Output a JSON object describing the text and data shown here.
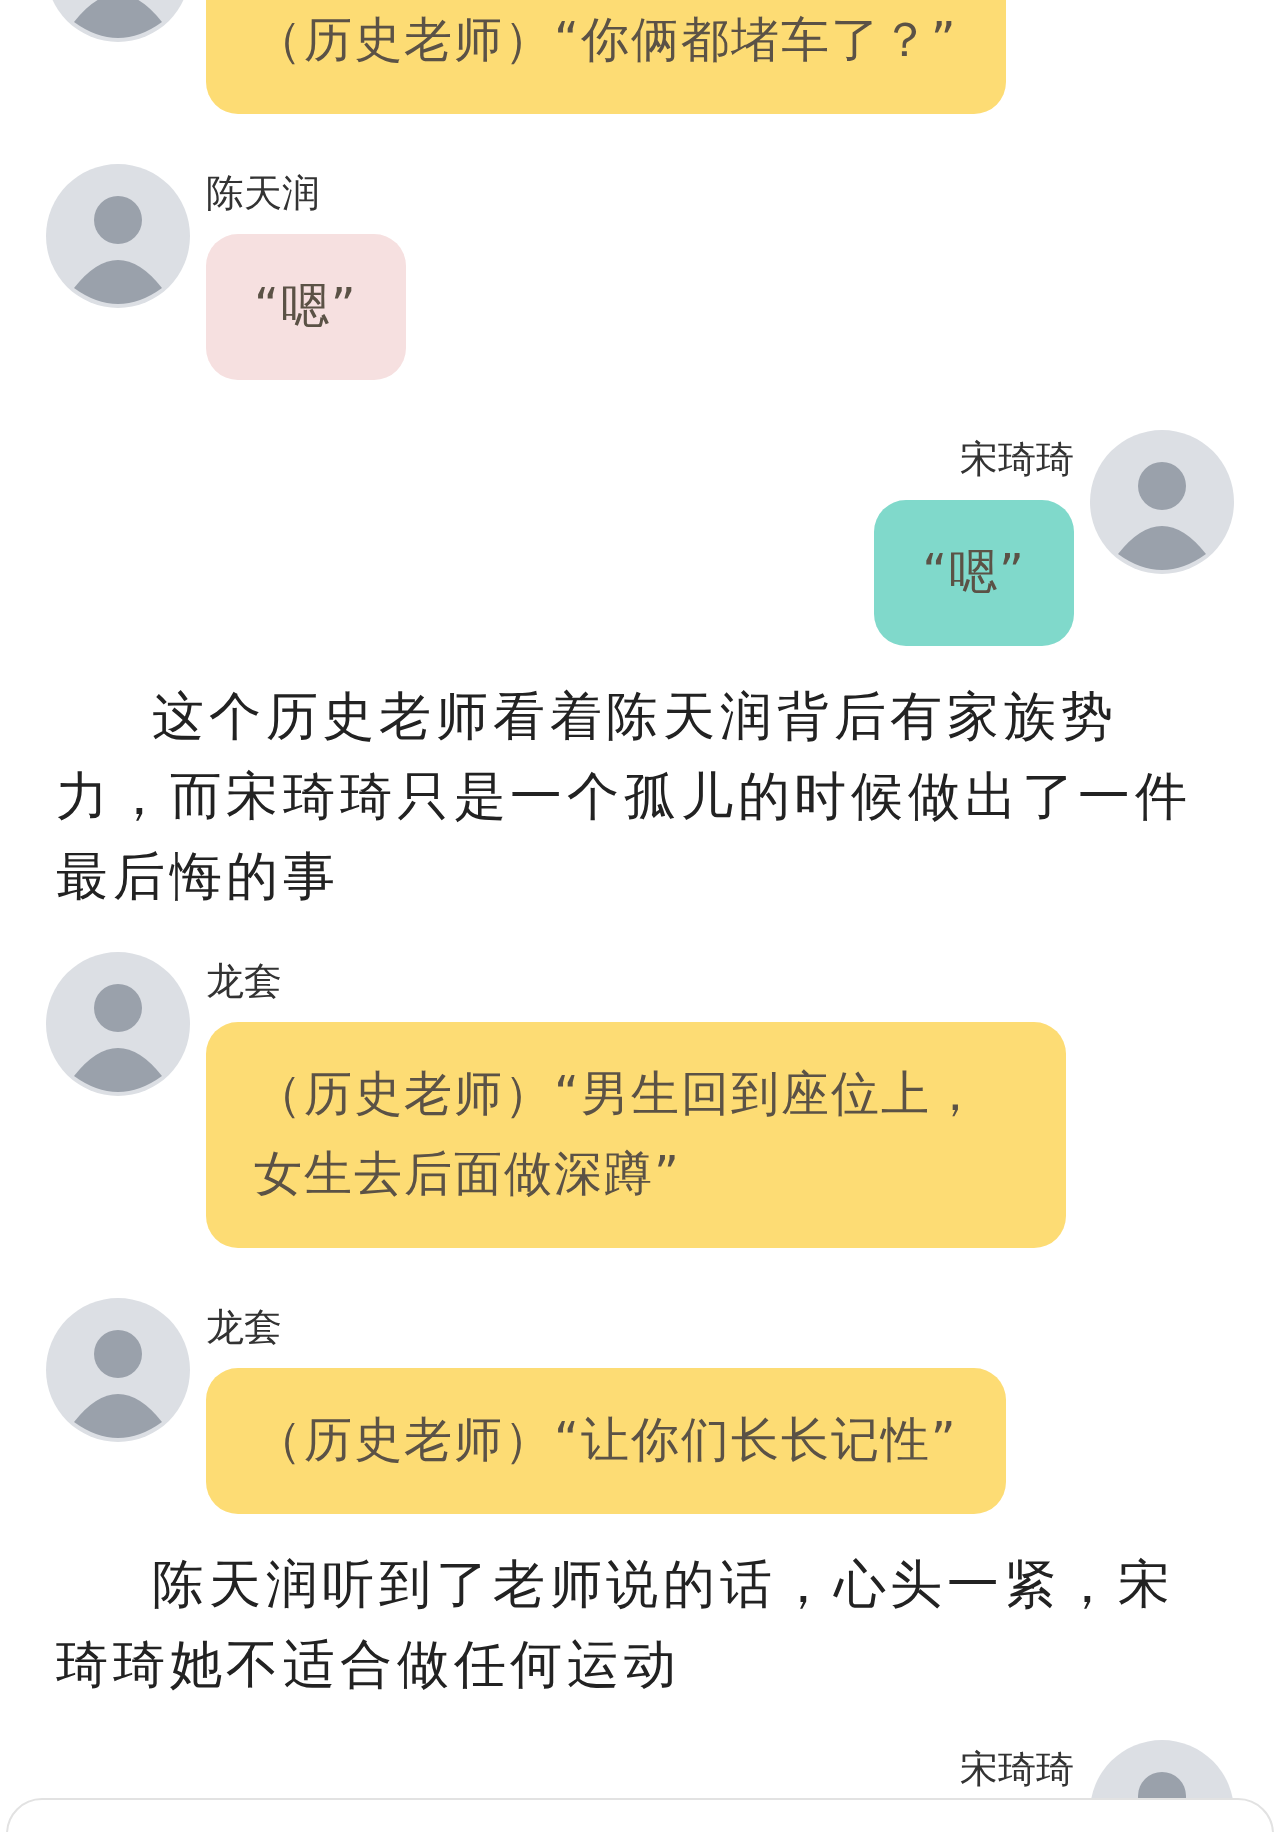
{
  "messages": [
    {
      "kind": "left",
      "text": "（历史老师）“你俩都堵车了？”",
      "color": "#fddc74"
    },
    {
      "kind": "left",
      "name": "陈天润",
      "text": "“嗯”",
      "color": "#f6e0e0"
    },
    {
      "kind": "right",
      "name": "宋琦琦",
      "text": "“嗯”",
      "color": "#80d9cb"
    },
    {
      "kind": "narration",
      "text": "这个历史老师看着陈天润背后有家族势力，而宋琦琦只是一个孤儿的时候做出了一件最后悔的事"
    },
    {
      "kind": "left",
      "name": "龙套",
      "text": "（历史老师）“男生回到座位上，女生去后面做深蹲”",
      "color": "#fddc74"
    },
    {
      "kind": "left",
      "name": "龙套",
      "text": "（历史老师）“让你们长长记性”",
      "color": "#fddc74"
    },
    {
      "kind": "narration",
      "text": "陈天润听到了老师说的话，心头一紧，宋琦琦她不适合做任何运动"
    },
    {
      "kind": "right",
      "name": "宋琦琦"
    }
  ]
}
